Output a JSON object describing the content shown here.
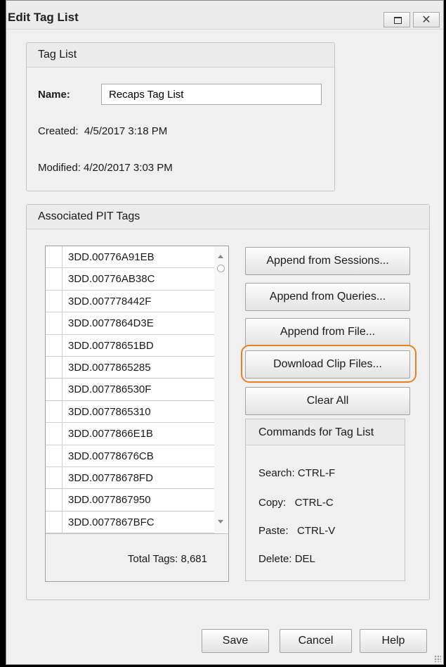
{
  "window": {
    "title": "Edit Tag List"
  },
  "tag_list_group": {
    "header": "Tag List",
    "name_label": "Name:",
    "name_value": "Recaps Tag List",
    "created": "Created:  4/5/2017 3:18 PM",
    "modified": "Modified: 4/20/2017 3:03 PM"
  },
  "pit_group": {
    "header": "Associated PIT Tags",
    "tags": [
      "3DD.00776A91EB",
      "3DD.00776AB38C",
      "3DD.007778442F",
      "3DD.0077864D3E",
      "3DD.00778651BD",
      "3DD.0077865285",
      "3DD.007786530F",
      "3DD.0077865310",
      "3DD.0077866E1B",
      "3DD.00778676CB",
      "3DD.00778678FD",
      "3DD.0077867950",
      "3DD.0077867BFC"
    ],
    "total": "Total Tags: 8,681"
  },
  "buttons": {
    "append_sessions": "Append from Sessions...",
    "append_queries": "Append from Queries...",
    "append_file": "Append from File...",
    "download_clip": "Download Clip Files...",
    "clear_all": "Clear All"
  },
  "commands": {
    "header": "Commands for Tag List",
    "search": "Search: CTRL-F",
    "copy": "Copy:   CTRL-C",
    "paste": "Paste:   CTRL-V",
    "delete": "Delete: DEL"
  },
  "footer": {
    "save": "Save",
    "cancel": "Cancel",
    "help": "Help"
  },
  "colors": {
    "highlight": "#ea7f24"
  }
}
